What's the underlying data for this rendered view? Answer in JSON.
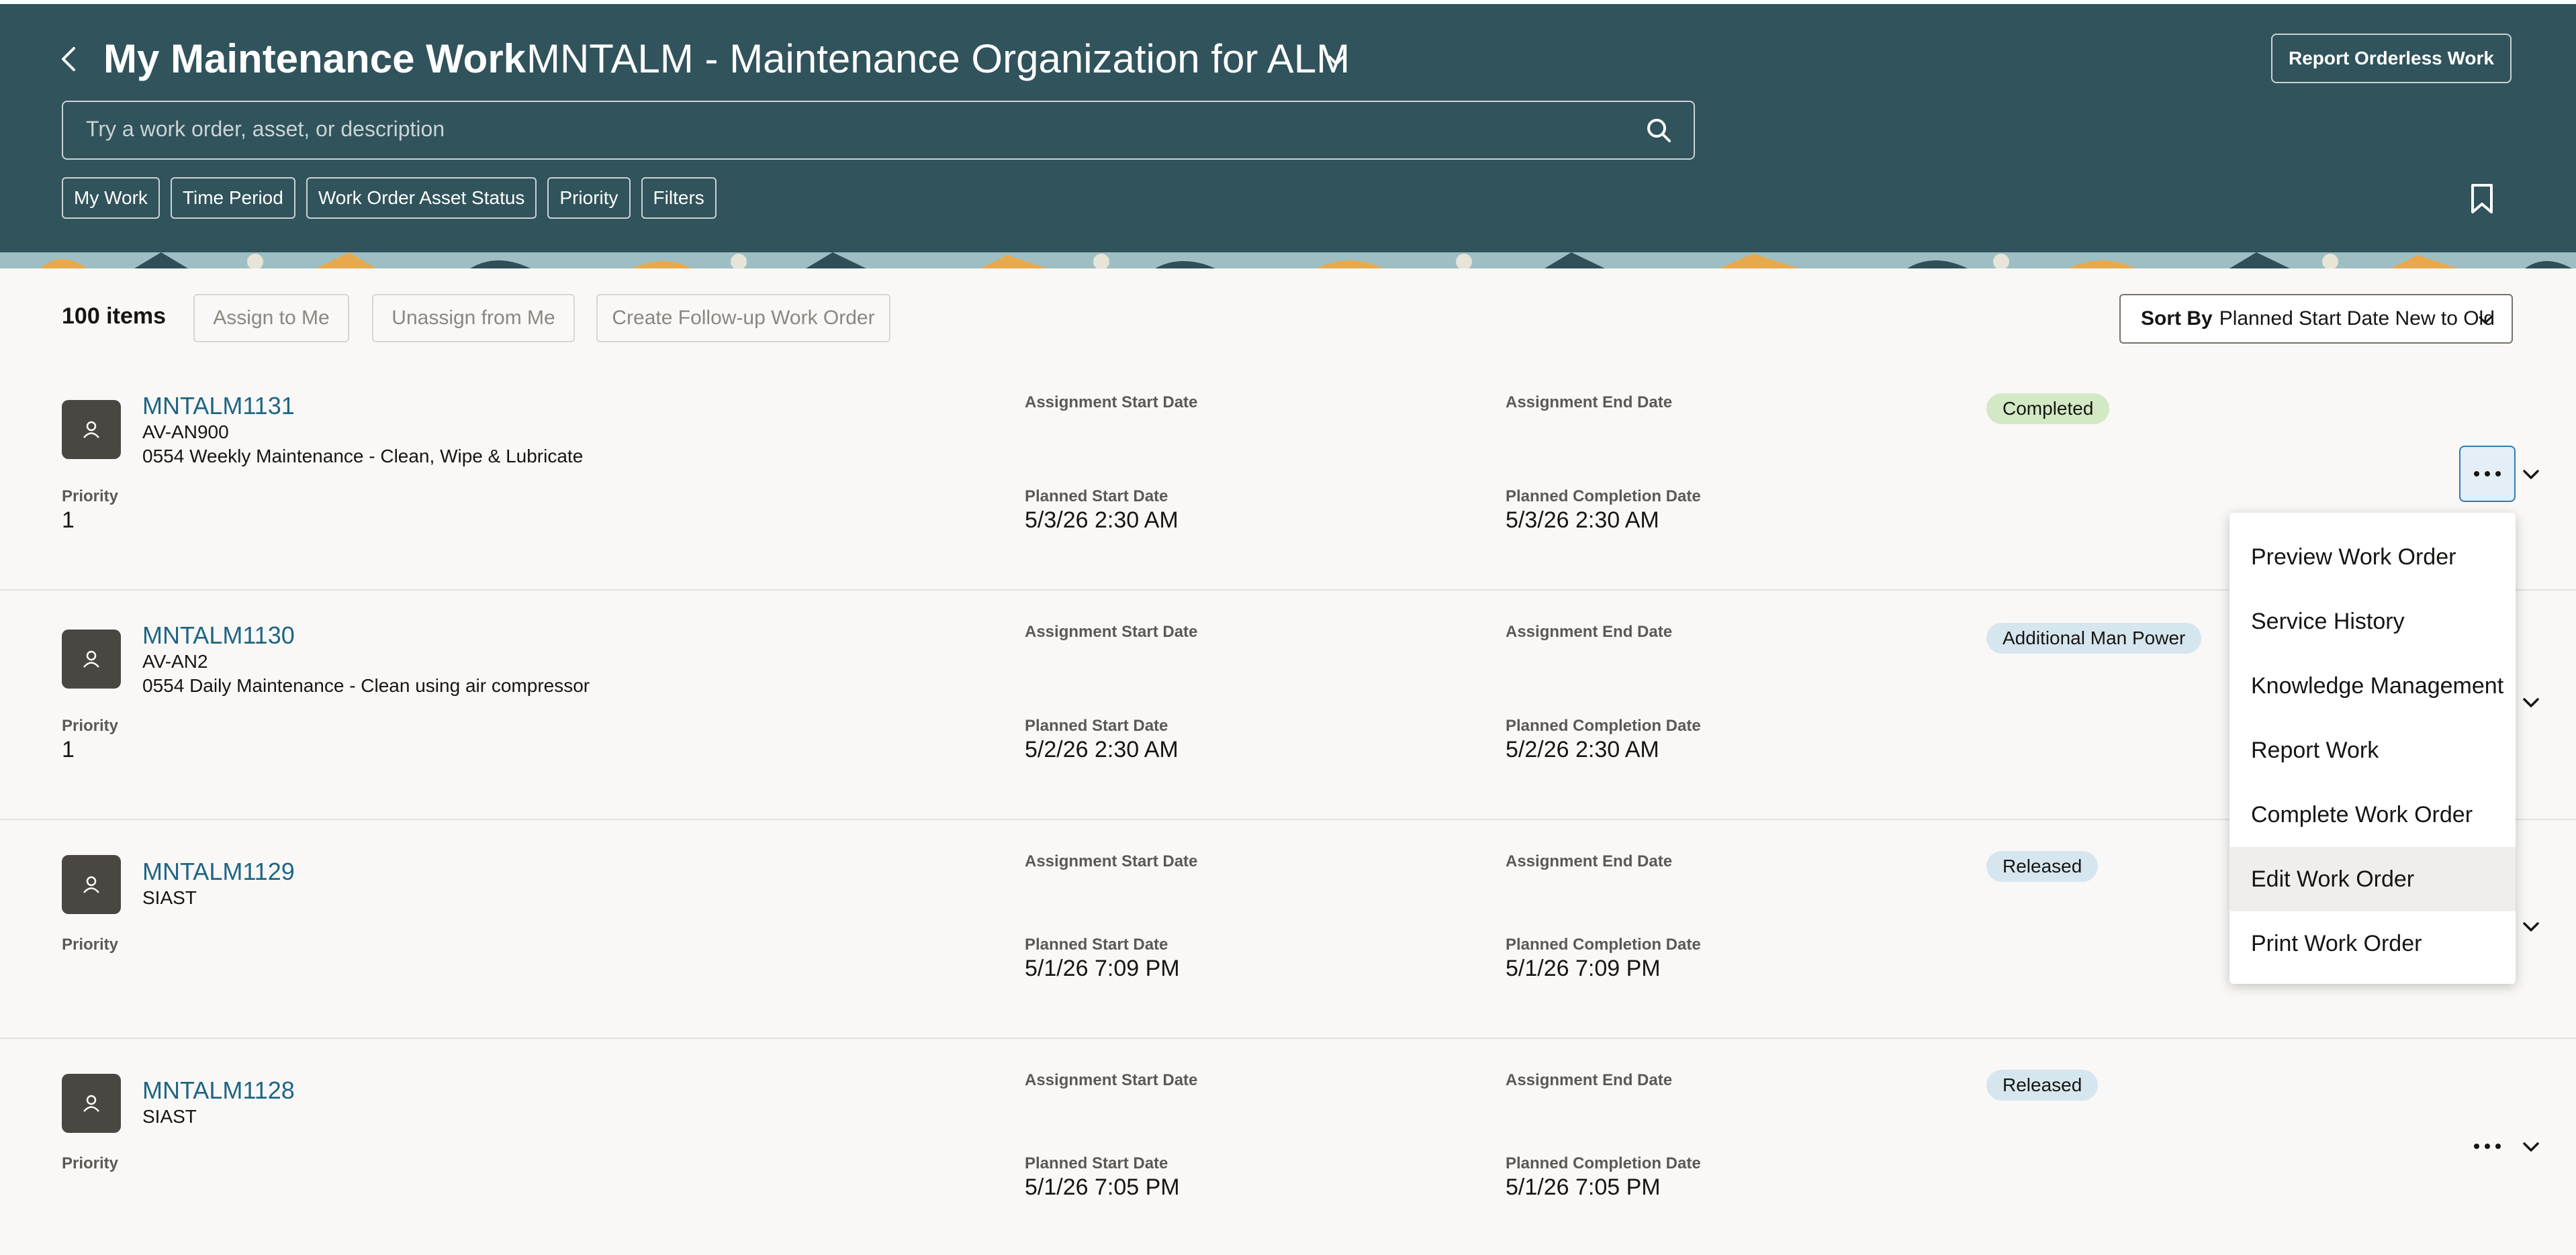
{
  "header": {
    "title": "My Maintenance Work",
    "organization": "MNTALM - Maintenance Organization for ALM",
    "report_button": "Report Orderless Work",
    "search_placeholder": "Try a work order, asset, or description",
    "filters": [
      "My Work",
      "Time Period",
      "Work Order Asset Status",
      "Priority",
      "Filters"
    ]
  },
  "toolbar": {
    "count": "100 items",
    "assign_label": "Assign to Me",
    "unassign_label": "Unassign from Me",
    "followup_label": "Create Follow-up Work Order",
    "sort_prefix": "Sort By",
    "sort_value": "Planned Start Date New to Old"
  },
  "labels": {
    "assignment_start": "Assignment Start Date",
    "assignment_end": "Assignment End Date",
    "priority": "Priority",
    "planned_start": "Planned Start Date",
    "planned_completion": "Planned Completion Date"
  },
  "rows": [
    {
      "work_order": "MNTALM1131",
      "asset": "AV-AN900",
      "description": "0554 Weekly Maintenance - Clean, Wipe & Lubricate",
      "priority": "1",
      "planned_start": "5/3/26 2:30 AM",
      "planned_completion": "5/3/26 2:30 AM",
      "status": "Completed"
    },
    {
      "work_order": "MNTALM1130",
      "asset": "AV-AN2",
      "description": "0554 Daily Maintenance - Clean using air compressor",
      "priority": "1",
      "planned_start": "5/2/26 2:30 AM",
      "planned_completion": "5/2/26 2:30 AM",
      "status": "Additional Man Power"
    },
    {
      "work_order": "MNTALM1129",
      "asset": "SIAST",
      "planned_start": "5/1/26 7:09 PM",
      "planned_completion": "5/1/26 7:09 PM",
      "status": "Released"
    },
    {
      "work_order": "MNTALM1128",
      "asset": "SIAST",
      "planned_start": "5/1/26 7:05 PM",
      "planned_completion": "5/1/26 7:05 PM",
      "status": "Released"
    }
  ],
  "menu": [
    "Preview Work Order",
    "Service History",
    "Knowledge Management",
    "Report Work",
    "Complete Work Order",
    "Edit Work Order",
    "Print Work Order"
  ],
  "colors": {
    "header_bg": "#31535b",
    "link": "#1e6585",
    "badge_completed": "#d3e8c4",
    "badge_info": "#d6e6ef"
  }
}
